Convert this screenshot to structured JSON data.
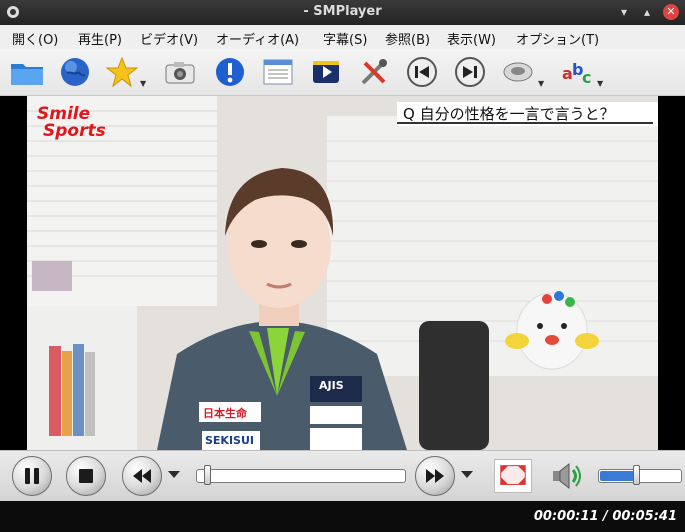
{
  "window": {
    "title": "- SMPlayer",
    "minimize": "▾",
    "maximize": "▴",
    "close": "✕"
  },
  "menu": [
    {
      "label": "開く(O)"
    },
    {
      "label": "再生(P)"
    },
    {
      "label": "ビデオ(V)"
    },
    {
      "label": "オーディオ(A)"
    },
    {
      "label": "字幕(S)"
    },
    {
      "label": "参照(B)"
    },
    {
      "label": "表示(W)"
    },
    {
      "label": "オプション(T)"
    }
  ],
  "toolbar": {
    "icons": [
      "open-folder-icon",
      "globe-icon",
      "favorites-star-icon",
      "screenshot-camera-icon",
      "info-icon",
      "playlist-icon",
      "video-equalizer-icon",
      "preferences-tools-icon",
      "previous-icon",
      "next-icon",
      "audio-track-icon",
      "subtitles-icon"
    ]
  },
  "video": {
    "brand_line1": "Smile",
    "brand_line2": "Sports",
    "caption": "Q 自分の性格を一言で言うと？",
    "jersey_text": [
      "日本生命",
      "AJIS",
      "SEKISUI"
    ]
  },
  "controls": {
    "seek_position": 0.05,
    "volume_level": 0.45
  },
  "status": {
    "time": "00:00:11 / 00:05:41"
  }
}
